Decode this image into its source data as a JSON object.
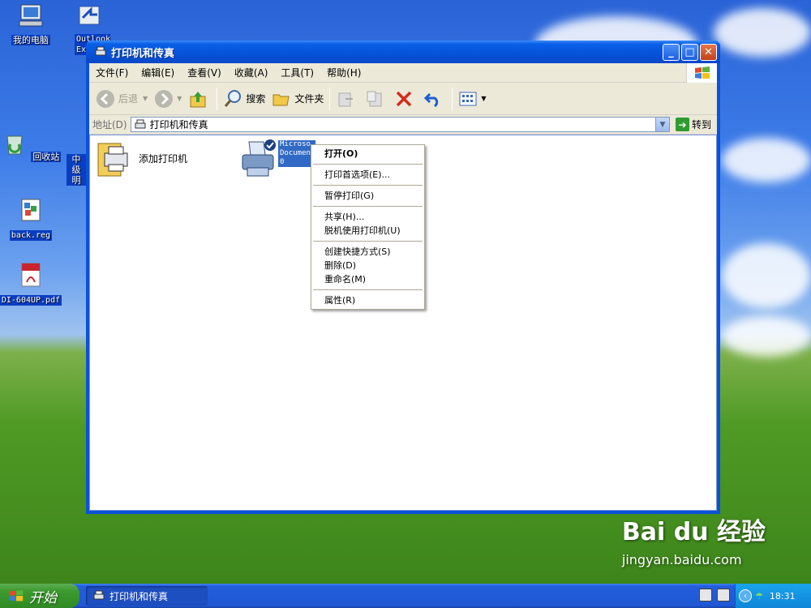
{
  "desktop": {
    "icons": [
      {
        "label": "我的电脑",
        "icon": "my-computer-icon"
      },
      {
        "label": "Outlook Ex",
        "icon": "outlook-express-icon"
      },
      {
        "label": "回收站",
        "icon": "recycle-bin-icon"
      },
      {
        "label": "back.reg",
        "icon": "registry-file-icon"
      },
      {
        "label": "DI-604UP.pdf",
        "icon": "pdf-icon"
      }
    ],
    "partial_label": "中级 明"
  },
  "window": {
    "title": "打印机和传真",
    "menu": [
      "文件(F)",
      "编辑(E)",
      "查看(V)",
      "收藏(A)",
      "工具(T)",
      "帮助(H)"
    ],
    "toolbar": {
      "back": "后退",
      "search": "搜索",
      "folders": "文件夹"
    },
    "address": {
      "label": "地址(D)",
      "value": "打印机和传真",
      "go": "转到"
    },
    "items": [
      {
        "label": "添加打印机",
        "icon": "add-printer-icon"
      },
      {
        "label": "Microsoft Office Document Image Writer",
        "label_visible": "Microso Documen 0",
        "icon": "printer-icon"
      }
    ]
  },
  "context_menu": {
    "items": [
      {
        "label": "打开(O)",
        "default": true
      },
      {
        "sep": true
      },
      {
        "label": "打印首选项(E)..."
      },
      {
        "sep": true
      },
      {
        "label": "暂停打印(G)"
      },
      {
        "sep": true
      },
      {
        "label": "共享(H)..."
      },
      {
        "label": "脱机使用打印机(U)"
      },
      {
        "sep": true
      },
      {
        "label": "创建快捷方式(S)"
      },
      {
        "label": "删除(D)"
      },
      {
        "label": "重命名(M)"
      },
      {
        "sep": true
      },
      {
        "label": "属性(R)"
      }
    ]
  },
  "taskbar": {
    "start": "开始",
    "task": "打印机和传真",
    "clock": "18:31"
  },
  "watermark": {
    "brand": "Bai du 经验",
    "url": "jingyan.baidu.com"
  }
}
